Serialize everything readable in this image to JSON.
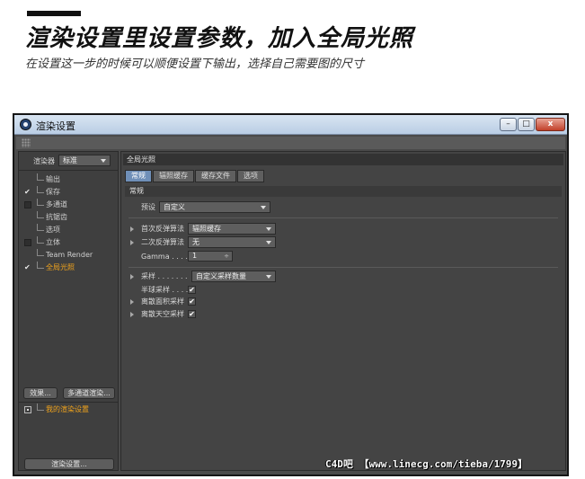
{
  "header": {
    "title": "渲染设置里设置参数，加入全局光照",
    "subtitle": "在设置这一步的时候可以顺便设置下输出，选择自己需要图的尺寸"
  },
  "window": {
    "title": "渲染设置",
    "controls": {
      "minimize": "–",
      "maximize": "□",
      "close": "x"
    }
  },
  "left_panel": {
    "renderer_label": "渲染器",
    "renderer_value": "标准",
    "tree": [
      {
        "label": "输出",
        "state": "none"
      },
      {
        "label": "保存",
        "state": "checked"
      },
      {
        "label": "多通道",
        "state": "unchecked"
      },
      {
        "label": "抗锯齿",
        "state": "none"
      },
      {
        "label": "选项",
        "state": "none"
      },
      {
        "label": "立体",
        "state": "unchecked"
      },
      {
        "label": "Team Render",
        "state": "none"
      },
      {
        "label": "全局光照",
        "state": "checked",
        "active": true
      }
    ],
    "effects_button": "效果...",
    "multipass_button": "多通道渲染...",
    "preset_label": "我的渲染设置",
    "render_settings_button": "渲染设置..."
  },
  "right_panel": {
    "section_title": "全局光照",
    "tabs": [
      "常规",
      "辐照缓存",
      "缓存文件",
      "选项"
    ],
    "active_tab": 0,
    "group_title": "常规",
    "preset": {
      "label": "预设",
      "value": "自定义"
    },
    "primary_method": {
      "label": "首次反弹算法",
      "value": "辐照缓存"
    },
    "secondary_method": {
      "label": "二次反弹算法",
      "value": "无"
    },
    "gamma": {
      "label": "Gamma . . . .",
      "value": "1",
      "spinner": "÷"
    },
    "sampling": {
      "label": "采样 . . . . . . .",
      "value": "自定义采样数量"
    },
    "hemisphere": {
      "label": "半球采样 . . . .",
      "checked": true
    },
    "area_lights": {
      "label": "离散面积采样",
      "checked": true
    },
    "sky_lights": {
      "label": "离散天空采样",
      "checked": true
    }
  },
  "watermark": "C4D吧 【www.linecg.com/tieba/1799】",
  "colors": {
    "accent_orange": "#f0a31c",
    "active_tab": "#6f8fb8",
    "panel_bg": "#444444"
  }
}
